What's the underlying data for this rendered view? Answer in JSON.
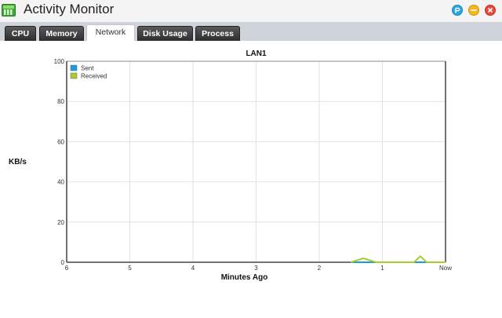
{
  "app": {
    "title": "Activity Monitor",
    "icon": "activity-monitor-icon"
  },
  "window_buttons": {
    "help": "help-icon",
    "minimize": "minimize-icon",
    "close": "close-icon"
  },
  "tabs": [
    {
      "label": "CPU",
      "active": false
    },
    {
      "label": "Memory",
      "active": false
    },
    {
      "label": "Network",
      "active": true
    },
    {
      "label": "Disk Usage",
      "active": false
    },
    {
      "label": "Process",
      "active": false
    }
  ],
  "colors": {
    "sent": "#1a9be0",
    "received": "#a8cc2c",
    "grid": "#e2e2e2",
    "frame": "#444444"
  },
  "chart_data": {
    "type": "line",
    "title": "LAN1",
    "xlabel": "Minutes Ago",
    "ylabel": "KB/s",
    "ylim": [
      0,
      100
    ],
    "xlim": [
      6,
      0
    ],
    "y_ticks": [
      "0",
      "20",
      "40",
      "60",
      "80",
      "100"
    ],
    "x_ticks": [
      "6",
      "5",
      "4",
      "3",
      "2",
      "1",
      "Now"
    ],
    "legend_position": "top-left",
    "grid": true,
    "series": [
      {
        "name": "Sent",
        "color": "#1a9be0",
        "x": [
          1.5,
          1.3,
          1.0,
          0.5,
          0.35,
          0
        ],
        "y": [
          0,
          0,
          0,
          0,
          0,
          0
        ]
      },
      {
        "name": "Received",
        "color": "#a8cc2c",
        "x": [
          1.5,
          1.3,
          1.1,
          1.0,
          0.7,
          0.5,
          0.4,
          0.3,
          0
        ],
        "y": [
          0,
          2,
          0,
          0,
          0,
          0,
          3,
          0,
          0
        ]
      }
    ]
  }
}
